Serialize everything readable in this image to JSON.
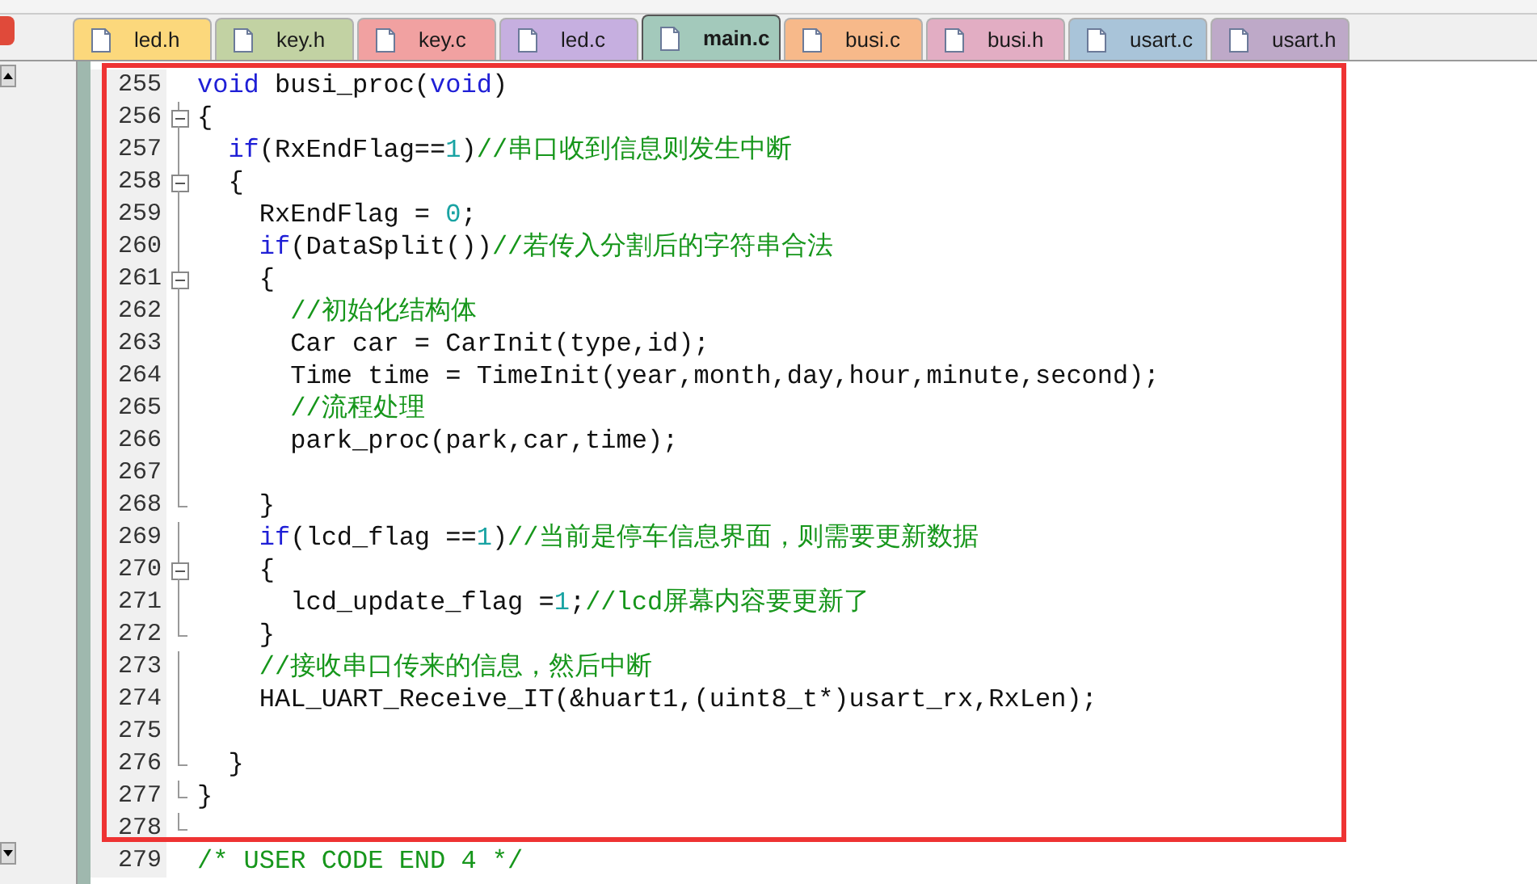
{
  "tabs": [
    {
      "label": "led.h",
      "color": "#fcd87c",
      "selected": false
    },
    {
      "label": "key.h",
      "color": "#c2d2a3",
      "selected": false
    },
    {
      "label": "key.c",
      "color": "#f1a1a1",
      "selected": false
    },
    {
      "label": "led.c",
      "color": "#c6afe0",
      "selected": false
    },
    {
      "label": "main.c",
      "color": "#a3c9bb",
      "selected": true
    },
    {
      "label": "busi.c",
      "color": "#f7b98a",
      "selected": false
    },
    {
      "label": "busi.h",
      "color": "#e2adc3",
      "selected": false
    },
    {
      "label": "usart.c",
      "color": "#a9c4d9",
      "selected": false
    },
    {
      "label": "usart.h",
      "color": "#bea9c8",
      "selected": false
    }
  ],
  "editor": {
    "lines": [
      {
        "number": "255",
        "kind": "plain",
        "tokens": [
          {
            "kind": "kw",
            "text": "void"
          },
          {
            "kind": "plain",
            "text": " busi_proc("
          },
          {
            "kind": "kw",
            "text": "void"
          },
          {
            "kind": "plain",
            "text": ")"
          }
        ]
      },
      {
        "number": "256",
        "kind": "fold_start",
        "tokens": [
          {
            "kind": "plain",
            "text": "{"
          }
        ]
      },
      {
        "number": "257",
        "kind": "fold_body",
        "tokens": [
          {
            "kind": "kw",
            "text": "  if"
          },
          {
            "kind": "plain",
            "text": "(RxEndFlag=="
          },
          {
            "kind": "num",
            "text": "1"
          },
          {
            "kind": "plain",
            "text": ")"
          },
          {
            "kind": "comment",
            "text": "//串口收到信息则发生中断"
          }
        ]
      },
      {
        "number": "258",
        "kind": "fold_start",
        "tokens": [
          {
            "kind": "plain",
            "text": "  {"
          }
        ]
      },
      {
        "number": "259",
        "kind": "fold_body",
        "tokens": [
          {
            "kind": "plain",
            "text": "    RxEndFlag = "
          },
          {
            "kind": "num",
            "text": "0"
          },
          {
            "kind": "plain",
            "text": ";"
          }
        ]
      },
      {
        "number": "260",
        "kind": "fold_body",
        "tokens": [
          {
            "kind": "kw",
            "text": "    if"
          },
          {
            "kind": "plain",
            "text": "(DataSplit())"
          },
          {
            "kind": "comment",
            "text": "//若传入分割后的字符串合法"
          }
        ]
      },
      {
        "number": "261",
        "kind": "fold_start",
        "tokens": [
          {
            "kind": "plain",
            "text": "    {"
          }
        ]
      },
      {
        "number": "262",
        "kind": "fold_body",
        "tokens": [
          {
            "kind": "comment",
            "text": "      //初始化结构体"
          }
        ]
      },
      {
        "number": "263",
        "kind": "fold_body",
        "tokens": [
          {
            "kind": "plain",
            "text": "      Car car = CarInit(type,id);"
          }
        ]
      },
      {
        "number": "264",
        "kind": "fold_body",
        "tokens": [
          {
            "kind": "plain",
            "text": "      Time time = TimeInit(year,month,day,hour,minute,second);"
          }
        ]
      },
      {
        "number": "265",
        "kind": "fold_body",
        "tokens": [
          {
            "kind": "comment",
            "text": "      //流程处理"
          }
        ]
      },
      {
        "number": "266",
        "kind": "fold_body",
        "tokens": [
          {
            "kind": "plain",
            "text": "      park_proc(park,car,time);"
          }
        ]
      },
      {
        "number": "267",
        "kind": "fold_body"
      },
      {
        "number": "268",
        "kind": "fold_end",
        "tokens": [
          {
            "kind": "plain",
            "text": "    }"
          }
        ]
      },
      {
        "number": "269",
        "kind": "fold_body",
        "tokens": [
          {
            "kind": "kw",
            "text": "    if"
          },
          {
            "kind": "plain",
            "text": "(lcd_flag =="
          },
          {
            "kind": "num",
            "text": "1"
          },
          {
            "kind": "plain",
            "text": ")"
          },
          {
            "kind": "comment",
            "text": "//当前是停车信息界面，则需要更新数据"
          }
        ]
      },
      {
        "number": "270",
        "kind": "fold_start",
        "tokens": [
          {
            "kind": "plain",
            "text": "    {"
          }
        ]
      },
      {
        "number": "271",
        "kind": "fold_body",
        "tokens": [
          {
            "kind": "plain",
            "text": "      lcd_update_flag ="
          },
          {
            "kind": "num",
            "text": "1"
          },
          {
            "kind": "plain",
            "text": ";"
          },
          {
            "kind": "comment",
            "text": "//lcd屏幕内容要更新了"
          }
        ]
      },
      {
        "number": "272",
        "kind": "fold_end",
        "tokens": [
          {
            "kind": "plain",
            "text": "    }"
          }
        ]
      },
      {
        "number": "273",
        "kind": "fold_body",
        "tokens": [
          {
            "kind": "comment",
            "text": "    //接收串口传来的信息，然后中断"
          }
        ]
      },
      {
        "number": "274",
        "kind": "fold_body",
        "tokens": [
          {
            "kind": "plain",
            "text": "    HAL_UART_Receive_IT(&huart1,(uint8_t*)usart_rx,RxLen);"
          }
        ]
      },
      {
        "number": "275",
        "kind": "fold_body"
      },
      {
        "number": "276",
        "kind": "fold_end",
        "tokens": [
          {
            "kind": "plain",
            "text": "  }"
          }
        ]
      },
      {
        "number": "277",
        "kind": "fold_end",
        "tokens": [
          {
            "kind": "plain",
            "text": "}"
          }
        ]
      },
      {
        "number": "278",
        "kind": "fold_end"
      },
      {
        "number": "279",
        "kind": "plain",
        "tokens": [
          {
            "kind": "comment",
            "text": "/* USER CODE END 4 */"
          }
        ]
      }
    ]
  }
}
